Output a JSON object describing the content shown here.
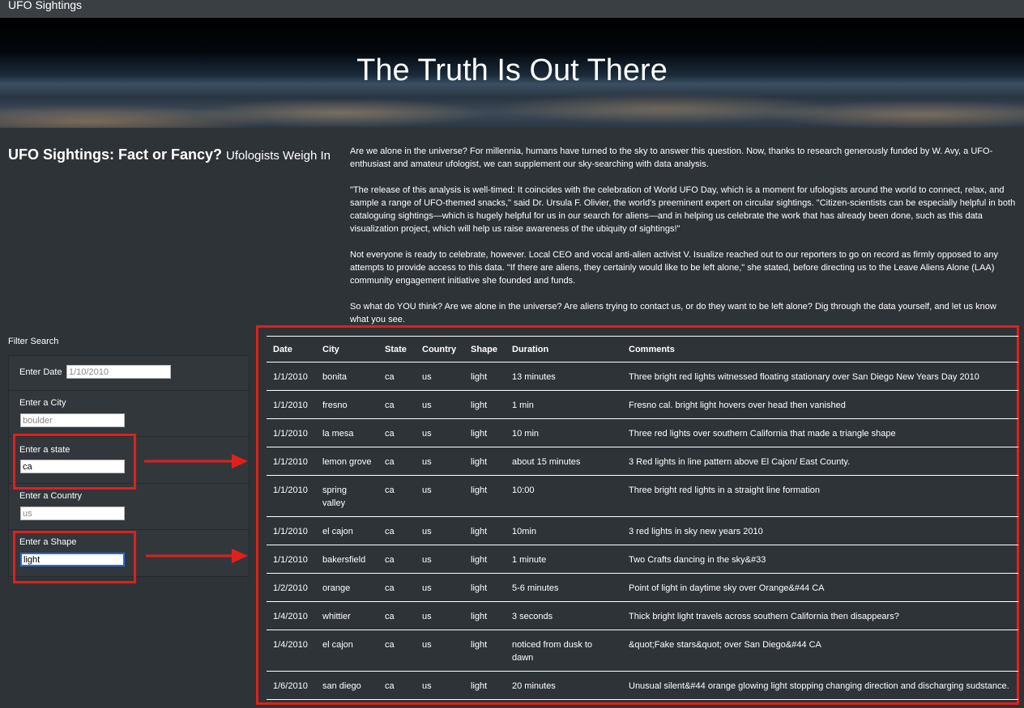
{
  "navbar": {
    "brand": "UFO Sightings"
  },
  "hero": {
    "title": "The Truth Is Out There"
  },
  "article": {
    "title": "UFO Sightings: Fact or Fancy?",
    "subtitle": "Ufologists Weigh In",
    "paragraphs": [
      "Are we alone in the universe? For millennia, humans have turned to the sky to answer this question. Now, thanks to research generously funded by W. Avy, a UFO-enthusiast and amateur ufologist, we can supplement our sky-searching with data analysis.",
      "\"The release of this analysis is well-timed: It coincides with the celebration of World UFO Day, which is a moment for ufologists around the world to connect, relax, and sample a range of UFO-themed snacks,\" said Dr. Ursula F. Olivier, the world's preeminent expert on circular sightings. \"Citizen-scientists can be especially helpful in both cataloguing sightings—which is hugely helpful for us in our search for aliens—and in helping us celebrate the work that has already been done, such as this data visualization project, which will help us raise awareness of the ubiquity of sightings!\"",
      "Not everyone is ready to celebrate, however. Local CEO and vocal anti-alien activist V. Isualize reached out to our reporters to go on record as firmly opposed to any attempts to provide access to this data. \"If there are aliens, they certainly would like to be left alone,\" she stated, before directing us to the Leave Aliens Alone (LAA) community engagement initiative she founded and funds.",
      "So what do YOU think? Are we alone in the universe? Are aliens trying to contact us, or do they want to be left alone? Dig through the data yourself, and let us know what you see."
    ]
  },
  "filters": {
    "heading": "Filter Search",
    "date": {
      "label": "Enter Date",
      "value": "",
      "placeholder": "1/10/2010"
    },
    "city": {
      "label": "Enter a City",
      "value": "",
      "placeholder": "boulder"
    },
    "state": {
      "label": "Enter a state",
      "value": "ca",
      "placeholder": ""
    },
    "country": {
      "label": "Enter a Country",
      "value": "",
      "placeholder": "us"
    },
    "shape": {
      "label": "Enter a Shape",
      "value": "light",
      "placeholder": ""
    }
  },
  "table": {
    "headers": [
      "Date",
      "City",
      "State",
      "Country",
      "Shape",
      "Duration",
      "Comments"
    ],
    "rows": [
      [
        "1/1/2010",
        "bonita",
        "ca",
        "us",
        "light",
        "13 minutes",
        "Three bright red lights witnessed floating stationary over San Diego New Years Day 2010"
      ],
      [
        "1/1/2010",
        "fresno",
        "ca",
        "us",
        "light",
        "1 min",
        "Fresno cal. bright light hovers over head then vanished"
      ],
      [
        "1/1/2010",
        "la mesa",
        "ca",
        "us",
        "light",
        "10 min",
        "Three red lights over southern California that made a triangle shape"
      ],
      [
        "1/1/2010",
        "lemon grove",
        "ca",
        "us",
        "light",
        "about 15 minutes",
        "3 Red lights in line pattern above El Cajon/ East County."
      ],
      [
        "1/1/2010",
        "spring valley",
        "ca",
        "us",
        "light",
        "10:00",
        "Three bright red lights in a straight line formation"
      ],
      [
        "1/1/2010",
        "el cajon",
        "ca",
        "us",
        "light",
        "10min",
        "3 red lights in sky new years 2010"
      ],
      [
        "1/1/2010",
        "bakersfield",
        "ca",
        "us",
        "light",
        "1 minute",
        "Two Crafts dancing in the sky&#33"
      ],
      [
        "1/2/2010",
        "orange",
        "ca",
        "us",
        "light",
        "5-6 minutes",
        "Point of light in daytime sky over Orange&#44 CA"
      ],
      [
        "1/4/2010",
        "whittier",
        "ca",
        "us",
        "light",
        "3 seconds",
        "Thick bright light travels across southern California then disappears?"
      ],
      [
        "1/4/2010",
        "el cajon",
        "ca",
        "us",
        "light",
        "noticed from dusk to dawn",
        "&quot;Fake stars&quot; over San Diego&#44 CA"
      ],
      [
        "1/6/2010",
        "san diego",
        "ca",
        "us",
        "light",
        "20 minutes",
        "Unusual silent&#44 orange glowing light stopping changing direction and discharging sudstance."
      ]
    ]
  },
  "colors": {
    "background": "#2e3338",
    "navbar": "#3a3f44",
    "highlight": "#e0201b",
    "focus": "#1f6fe0"
  }
}
